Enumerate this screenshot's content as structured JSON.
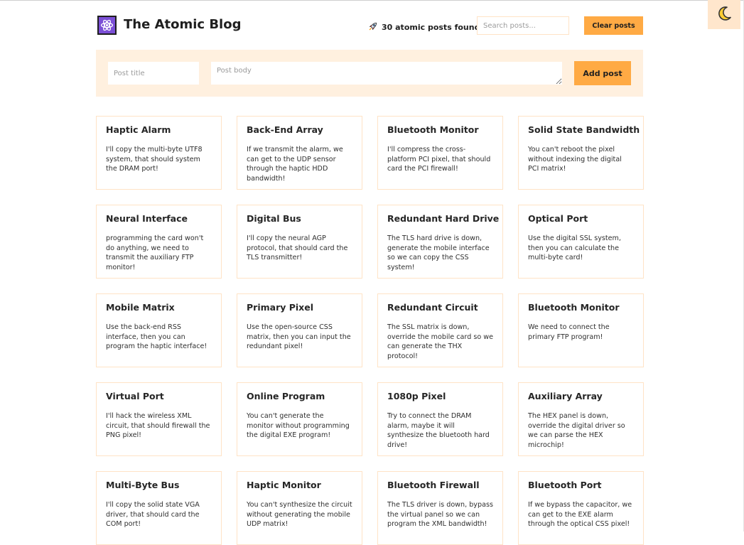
{
  "header": {
    "site_title": "The Atomic Blog",
    "logo_icon": "atom-icon",
    "post_count_icon": "rocket-icon",
    "post_count_text": "30 atomic posts found",
    "search_placeholder": "Search posts...",
    "clear_label": "Clear posts"
  },
  "theme_toggle": {
    "icon": "moon-icon"
  },
  "composer": {
    "title_placeholder": "Post title",
    "body_placeholder": "Post body",
    "add_label": "Add post"
  },
  "colors": {
    "accent": "#ffaa44",
    "composer_bg": "#fff0df",
    "card_border": "#ffe3c6",
    "toggle_bg": "#ffe6cc",
    "logo_bg": "#7b4fd6"
  },
  "posts": [
    {
      "title": "Haptic Alarm",
      "body": "I'll copy the multi-byte UTF8 system, that should system the DRAM port!"
    },
    {
      "title": "Back-End Array",
      "body": "If we transmit the alarm, we can get to the UDP sensor through the haptic HDD bandwidth!"
    },
    {
      "title": "Bluetooth Monitor",
      "body": "I'll compress the cross-platform PCI pixel, that should card the PCI firewall!"
    },
    {
      "title": "Solid State Bandwidth",
      "body": "You can't reboot the pixel without indexing the digital PCI matrix!"
    },
    {
      "title": "Neural Interface",
      "body": "programming the card won't do anything, we need to transmit the auxiliary FTP monitor!"
    },
    {
      "title": "Digital Bus",
      "body": "I'll copy the neural AGP protocol, that should card the TLS transmitter!"
    },
    {
      "title": "Redundant Hard Drive",
      "body": "The TLS hard drive is down, generate the mobile interface so we can copy the CSS system!"
    },
    {
      "title": "Optical Port",
      "body": "Use the digital SSL system, then you can calculate the multi-byte card!"
    },
    {
      "title": "Mobile Matrix",
      "body": "Use the back-end RSS interface, then you can program the haptic interface!"
    },
    {
      "title": "Primary Pixel",
      "body": "Use the open-source CSS matrix, then you can input the redundant pixel!"
    },
    {
      "title": "Redundant Circuit",
      "body": "The SSL matrix is down, override the mobile card so we can generate the THX protocol!"
    },
    {
      "title": "Bluetooth Monitor",
      "body": "We need to connect the primary FTP program!"
    },
    {
      "title": "Virtual Port",
      "body": "I'll hack the wireless XML circuit, that should firewall the PNG pixel!"
    },
    {
      "title": "Online Program",
      "body": "You can't generate the monitor without programming the digital EXE program!"
    },
    {
      "title": "1080p Pixel",
      "body": "Try to connect the DRAM alarm, maybe it will synthesize the bluetooth hard drive!"
    },
    {
      "title": "Auxiliary Array",
      "body": "The HEX panel is down, override the digital driver so we can parse the HEX microchip!"
    },
    {
      "title": "Multi-Byte Bus",
      "body": "I'll copy the solid state VGA driver, that should card the COM port!"
    },
    {
      "title": "Haptic Monitor",
      "body": "You can't synthesize the circuit without generating the mobile UDP matrix!"
    },
    {
      "title": "Bluetooth Firewall",
      "body": "The TLS driver is down, bypass the virtual panel so we can program the XML bandwidth!"
    },
    {
      "title": "Bluetooth Port",
      "body": "If we bypass the capacitor, we can get to the EXE alarm through the optical CSS pixel!"
    }
  ]
}
